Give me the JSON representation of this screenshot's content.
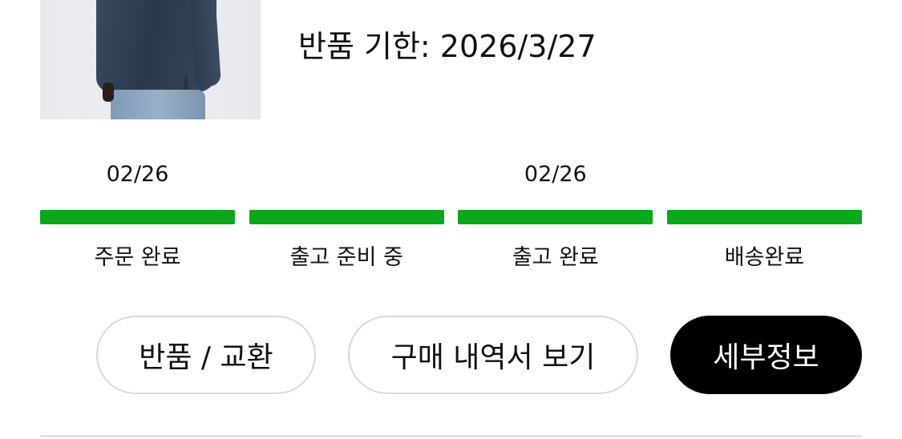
{
  "order": {
    "return_deadline": "반품 기한: 2026/3/27"
  },
  "progress": {
    "accent_color": "#0aa81a",
    "steps": [
      {
        "date": "02/26",
        "label": "주문 완료",
        "complete": 1
      },
      {
        "date": "",
        "label": "출고 준비 중",
        "complete": 1
      },
      {
        "date": "02/26",
        "label": "출고 완료",
        "complete": 1
      },
      {
        "date": "",
        "label": "배송완료",
        "complete": 1
      }
    ]
  },
  "actions": {
    "return_exchange_label": "반품 / 교환",
    "view_receipt_label": "구매 내역서 보기",
    "details_label": "세부정보"
  }
}
